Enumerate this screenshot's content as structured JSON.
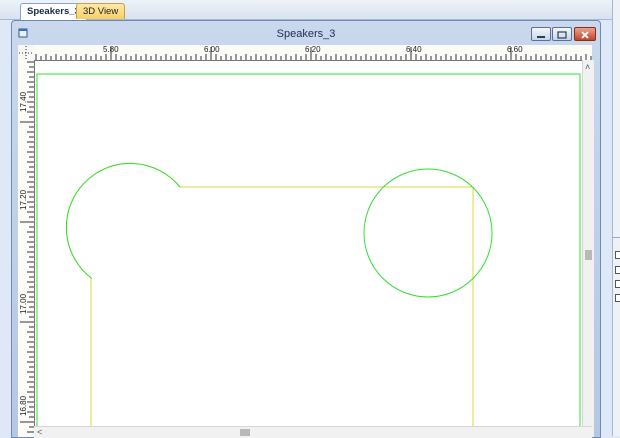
{
  "tabs": [
    {
      "label": "Speakers_3",
      "active": true
    },
    {
      "label": "3D View",
      "active": false
    }
  ],
  "window": {
    "title": "Speakers_3",
    "buttons": [
      "minimize",
      "maximize",
      "close"
    ]
  },
  "ruler": {
    "horizontal": [
      "5.80",
      "6.00",
      "6.20",
      "6.40",
      "6.60"
    ],
    "vertical": [
      "17.40",
      "17.20",
      "17.00",
      "16.80"
    ]
  },
  "colors": {
    "board_outline": "#d8d83a",
    "circles": "#33dd33",
    "border": "#33dd33",
    "background": "#ffffff"
  },
  "icons": {
    "window": "document-icon",
    "scroll_up": "chevron-up-icon",
    "scroll_down": "chevron-down-icon",
    "scroll_left": "chevron-left-icon"
  }
}
